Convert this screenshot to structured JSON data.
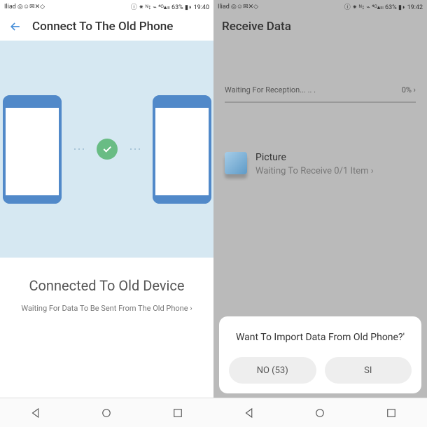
{
  "left": {
    "status": {
      "carrier": "Iliad ◎☺✉✕◇",
      "right": "ⓘ ⁕ ᴺ↕ ⌁ ⁴ᴳ▴ₗₗₗ 63% ▮◗ 19:40"
    },
    "header": {
      "title": "Connect To The Old Phone"
    },
    "connected": {
      "title": "Connected To Old Device",
      "sub": "Waiting For Data To Be Sent From The Old Phone ›"
    }
  },
  "right": {
    "status": {
      "carrier": "Iliad ◎☺✉✕◇",
      "right": "ⓘ ⁕ ᴺ↕ ⌁ ⁴ᴳ▴ₗₗₗ 63% ▮◗ 19:42"
    },
    "header": {
      "title": "Receive Data"
    },
    "progress": {
      "label": "Waiting For Reception... .. .",
      "pct": "0% ›"
    },
    "item": {
      "title": "Picture",
      "sub": "Waiting To Receive 0/1 Item ›"
    },
    "dialog": {
      "title": "Want To Import Data From Old Phone?'",
      "no": "NO (53)",
      "yes": "SI"
    }
  }
}
